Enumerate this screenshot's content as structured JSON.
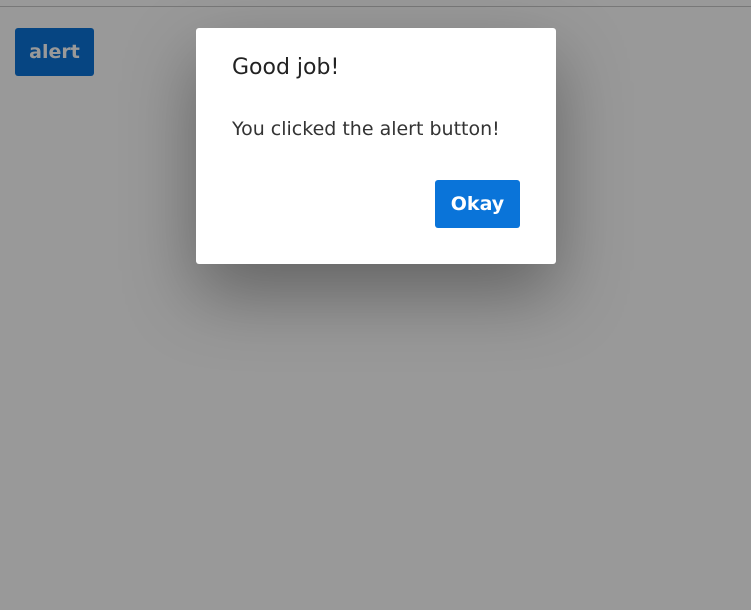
{
  "page": {
    "alert_button_label": "alert"
  },
  "dialog": {
    "title": "Good job!",
    "message": "You clicked the alert button!",
    "confirm_label": "Okay"
  },
  "colors": {
    "button_background": "#0a74d9",
    "overlay": "rgba(0,0,0,0.4)",
    "dialog_background": "#ffffff"
  }
}
